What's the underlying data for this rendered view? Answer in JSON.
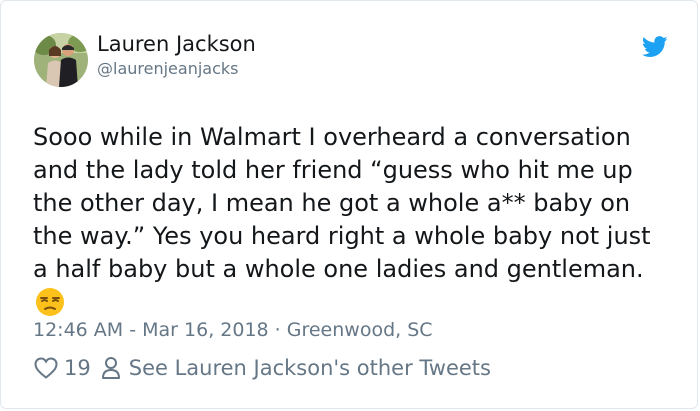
{
  "user": {
    "name": "Lauren Jackson",
    "handle": "@laurenjeanjacks",
    "avatar_icon": "profile-photo"
  },
  "tweet": {
    "lines": [
      "Sooo while in Walmart I overheard a conversation",
      "and the lady told her friend “guess who hit me up",
      "the other day, I mean he got a whole a** baby on",
      "the way.” Yes you heard right a whole baby not just",
      "a half baby but a whole one ladies and gentleman."
    ],
    "emoji": "unamused-face-emoji"
  },
  "meta": {
    "time": "12:46 AM",
    "date": "Mar 16, 2018",
    "location": "Greenwood, SC",
    "separator_dash": " - ",
    "separator_dot": " · "
  },
  "actions": {
    "like_count": "19",
    "see_other_label": "See Lauren Jackson's other Tweets",
    "like_icon": "heart-icon",
    "person_icon": "person-icon"
  },
  "colors": {
    "brand_blue": "#1da1f2",
    "text": "#14171a",
    "secondary": "#657786",
    "border": "#e1e8ed"
  }
}
